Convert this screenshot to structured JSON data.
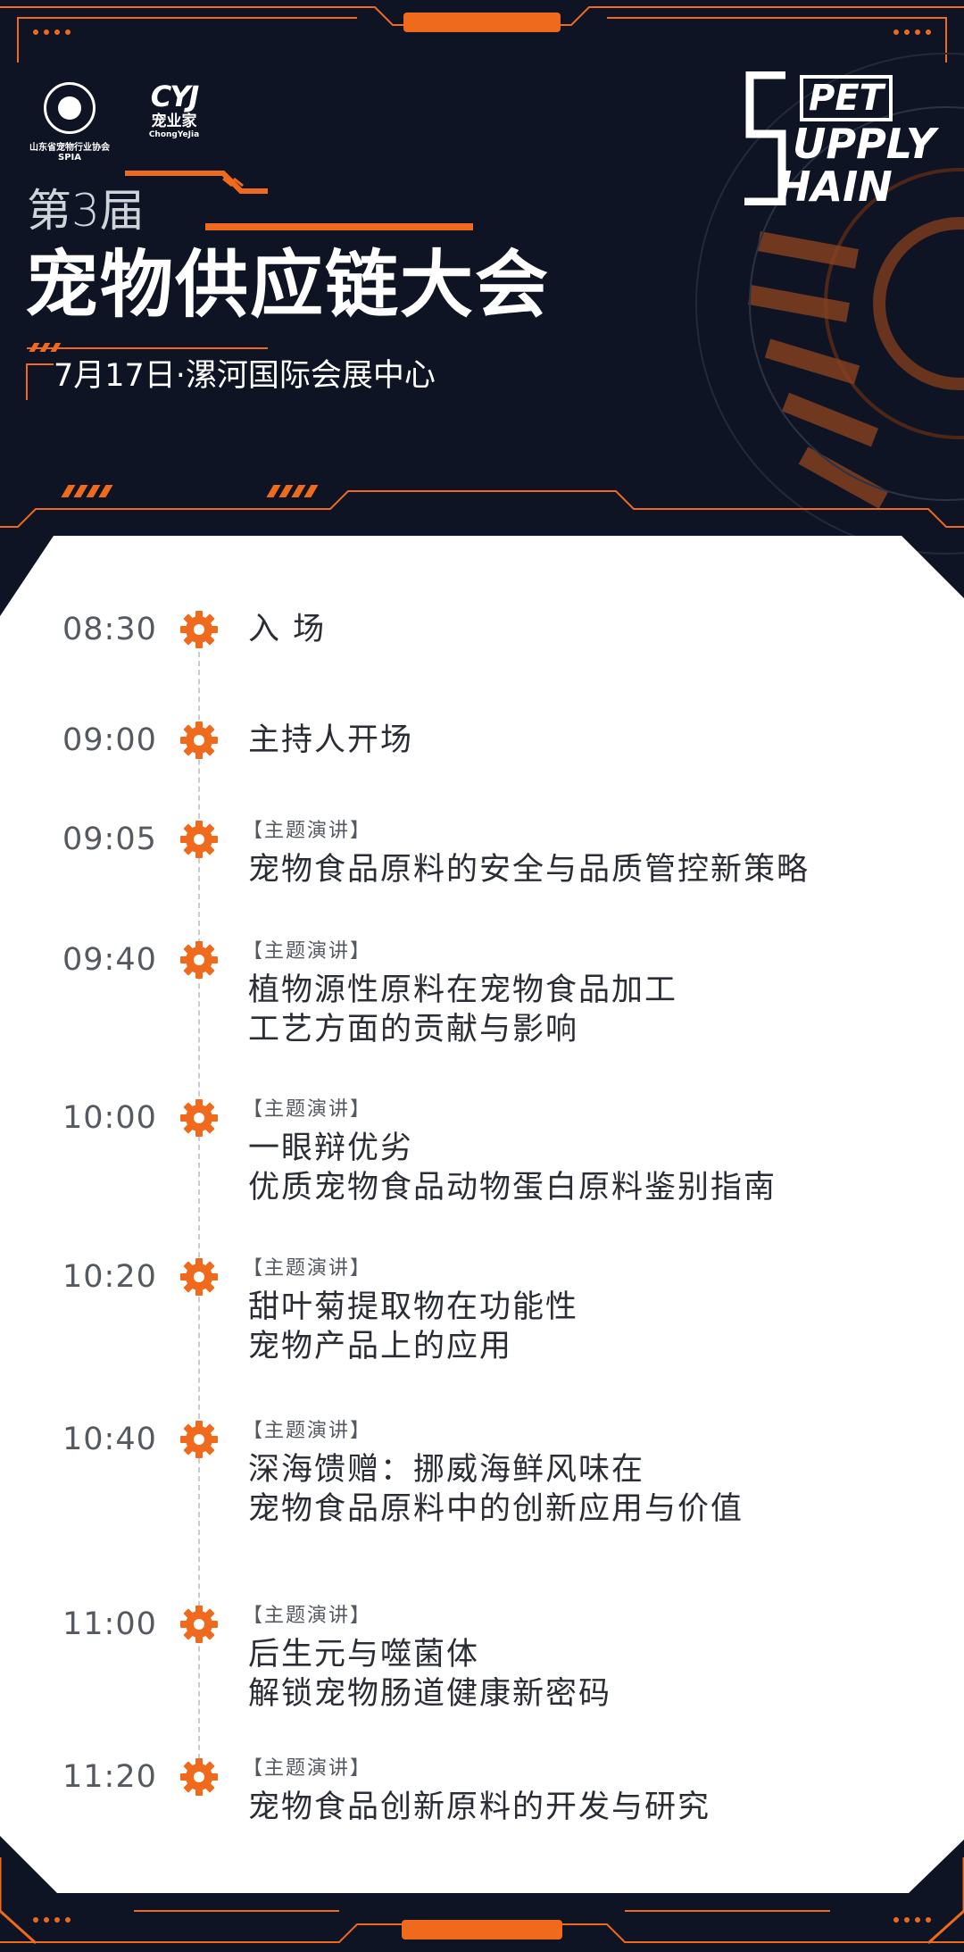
{
  "logos": {
    "spia_name": "山东省宠物行业协会",
    "spia_abbr": "SPIA",
    "cyj_mark": "CYJ",
    "cyj_name": "宠业家",
    "cyj_en": "ChongYeJia"
  },
  "event": {
    "edition": "第3届",
    "title": "宠物供应链大会",
    "date_location": "7月17日·漯河国际会展中心"
  },
  "pet_logo": {
    "pet": "PET",
    "supply": "UPPLY",
    "chain": "HAIN"
  },
  "colors": {
    "accent": "#f06a1e",
    "background": "#0e1424",
    "card": "#ffffff"
  },
  "schedule": [
    {
      "time": "08:30",
      "tag": "",
      "lines": [
        "入  场"
      ]
    },
    {
      "time": "09:00",
      "tag": "",
      "lines": [
        "主持人开场"
      ]
    },
    {
      "time": "09:05",
      "tag": "【主题演讲】",
      "lines": [
        "宠物食品原料的安全与品质管控新策略"
      ]
    },
    {
      "time": "09:40",
      "tag": "【主题演讲】",
      "lines": [
        "植物源性原料在宠物食品加工",
        "工艺方面的贡献与影响"
      ]
    },
    {
      "time": "10:00",
      "tag": "【主题演讲】",
      "lines": [
        "一眼辩优劣",
        "优质宠物食品动物蛋白原料鉴别指南"
      ]
    },
    {
      "time": "10:20",
      "tag": "【主题演讲】",
      "lines": [
        "甜叶菊提取物在功能性",
        "宠物产品上的应用"
      ]
    },
    {
      "time": "10:40",
      "tag": "【主题演讲】",
      "lines": [
        "深海馈赠：挪威海鲜风味在",
        "宠物食品原料中的创新应用与价值"
      ]
    },
    {
      "time": "11:00",
      "tag": "【主题演讲】",
      "lines": [
        "后生元与噬菌体",
        "解锁宠物肠道健康新密码"
      ]
    },
    {
      "time": "11:20",
      "tag": "【主题演讲】",
      "lines": [
        "宠物食品创新原料的开发与研究"
      ]
    }
  ]
}
